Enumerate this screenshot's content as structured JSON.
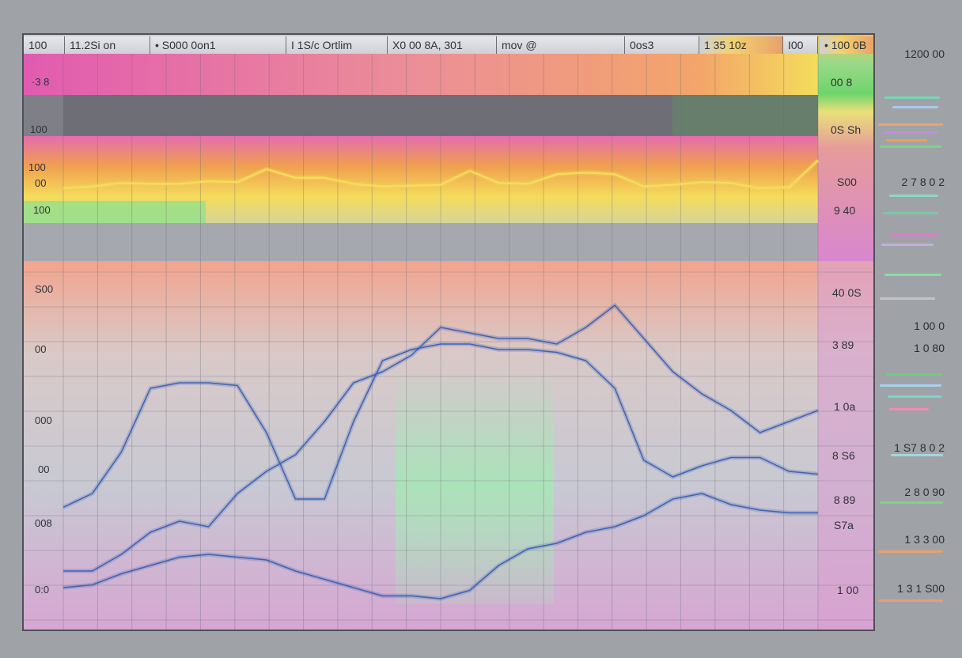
{
  "header": {
    "cells": [
      "100",
      "11.2Si  on",
      "• S000  0on1",
      "I 1S/c  Ortlim",
      "X0 00  8A, 301",
      "mov  @",
      "0os3",
      "1 35  10z",
      "I00",
      "• 100 0B"
    ]
  },
  "top_panel": {
    "left_labels": [
      "·3 8",
      "100",
      "100",
      "00",
      "100"
    ],
    "right_labels": [
      "00 8",
      "0S  Sh",
      "S00",
      "9 40"
    ]
  },
  "bottom_panel": {
    "left_labels": [
      "S00",
      "00",
      "000",
      "00",
      "008",
      "0:0"
    ],
    "right_labels": [
      "40 0S",
      "3 89",
      "1 0a",
      "8 S6",
      "8 89",
      "S7a",
      "1 00"
    ]
  },
  "side_panel": {
    "labels": [
      "1200 00",
      "2 7 8 0 2",
      "1 00  0",
      "1 0 80",
      "1 S7 8 0 2",
      "2 8 0 90",
      "1 3 3 00",
      "1 3 1 S00"
    ]
  },
  "colors": {
    "pink": "#e15bb0",
    "orange": "#f0a04e",
    "yellow": "#f4dc5c",
    "green": "#8ce28a",
    "line_blue": "#3f63b5"
  },
  "chart_data": [
    {
      "type": "line",
      "title": "",
      "xlabel": "",
      "ylabel": "",
      "x": [
        0,
        1,
        2,
        3,
        4,
        5,
        6,
        7,
        8,
        9,
        10,
        11,
        12,
        13,
        14,
        15,
        16,
        17,
        18,
        19,
        20,
        21,
        22,
        23,
        24,
        25,
        26
      ],
      "series": [
        {
          "values": [
            40,
            42,
            46,
            45,
            45,
            48,
            47,
            62,
            52,
            52,
            45,
            42,
            43,
            44,
            60,
            46,
            45,
            56,
            58,
            56,
            42,
            44,
            47,
            46,
            40,
            41,
            72
          ]
        }
      ],
      "ylim": [
        0,
        100
      ],
      "grid": true
    },
    {
      "type": "line",
      "title": "",
      "xlabel": "",
      "ylabel": "",
      "x": [
        0,
        1,
        2,
        3,
        4,
        5,
        6,
        7,
        8,
        9,
        10,
        11,
        12,
        13,
        14,
        15,
        16,
        17,
        18,
        19,
        20,
        21,
        22,
        23,
        24,
        25,
        26
      ],
      "series": [
        {
          "values": [
            35,
            40,
            55,
            78,
            80,
            80,
            79,
            62,
            38,
            38,
            66,
            88,
            92,
            94,
            94,
            92,
            92,
            91,
            88,
            78,
            52,
            46,
            50,
            53,
            53,
            48,
            47
          ]
        },
        {
          "values": [
            12,
            12,
            18,
            26,
            30,
            28,
            40,
            48,
            54,
            66,
            80,
            84,
            90,
            100,
            98,
            96,
            96,
            94,
            100,
            108,
            96,
            84,
            76,
            70,
            62,
            66,
            70
          ]
        },
        {
          "values": [
            6,
            7,
            11,
            14,
            17,
            18,
            17,
            16,
            12,
            9,
            6,
            3,
            3,
            2,
            5,
            14,
            20,
            22,
            26,
            28,
            32,
            38,
            40,
            36,
            34,
            33,
            33
          ]
        }
      ],
      "ylim": [
        0,
        120
      ],
      "grid": true
    }
  ]
}
